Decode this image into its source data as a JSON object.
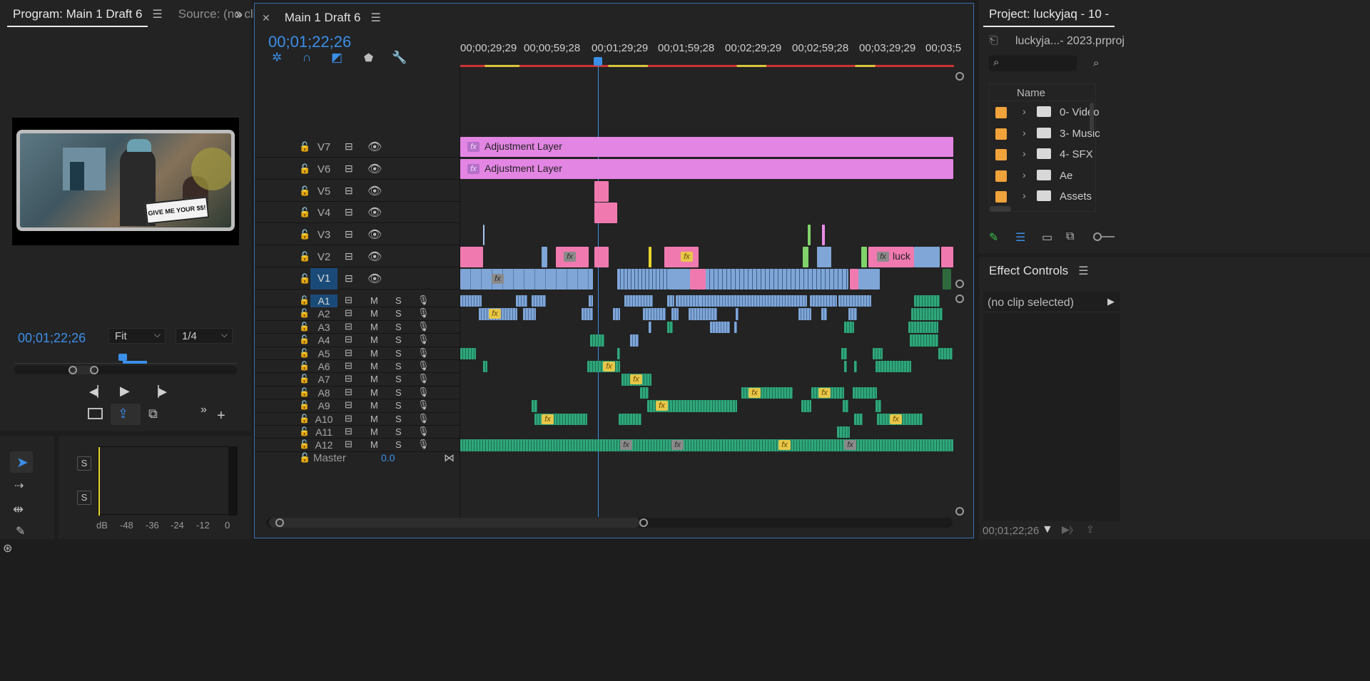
{
  "program_monitor": {
    "tab_program": "Program: Main 1 Draft 6",
    "tab_source": "Source: (no cli",
    "timecode": "00;01;22;26",
    "fit_label": "Fit",
    "resolution_label": "1/4",
    "caption": "GIVE ME YOUR $$!"
  },
  "timeline": {
    "tab_title": "Main 1 Draft 6",
    "timecode": "00;01;22;26",
    "ruler_labels": [
      "00;00;29;29",
      "00;00;59;28",
      "00;01;29;29",
      "00;01;59;28",
      "00;02;29;29",
      "00;02;59;28",
      "00;03;29;29",
      "00;03;5"
    ],
    "video_tracks": [
      "V7",
      "V6",
      "V5",
      "V4",
      "V3",
      "V2",
      "V1"
    ],
    "audio_tracks": [
      "A1",
      "A2",
      "A3",
      "A4",
      "A5",
      "A6",
      "A7",
      "A8",
      "A9",
      "A10",
      "A11",
      "A12"
    ],
    "mute_label": "M",
    "solo_label": "S",
    "master_label": "Master",
    "master_value": "0.0",
    "adjustment_layer_label": "Adjustment Layer",
    "clip_luck_label": "luck",
    "fx_label": "fx"
  },
  "audio_meter": {
    "solo_labels": [
      "S",
      "S"
    ],
    "scale_labels": [
      "dB",
      "-48",
      "-36",
      "-24",
      "-12",
      "0"
    ]
  },
  "project": {
    "tab_title": "Project: luckyjaq - 10 -",
    "file_name": "luckyja...- 2023.prproj",
    "column_name": "Name",
    "bins": [
      "0- Video",
      "3- Music",
      "4- SFX",
      "Ae",
      "Assets"
    ]
  },
  "effect_controls": {
    "tab_title": "Effect Controls",
    "no_clip": "(no clip selected)",
    "timecode": "00;01;22;26"
  },
  "colors": {
    "accent_blue": "#3b8fe8",
    "adjustment_pink": "#e385e3",
    "clip_pink": "#f07ab0",
    "clip_blue": "#7fa6d6",
    "audio_green": "#2fa77b",
    "bin_orange": "#f0a23b"
  }
}
